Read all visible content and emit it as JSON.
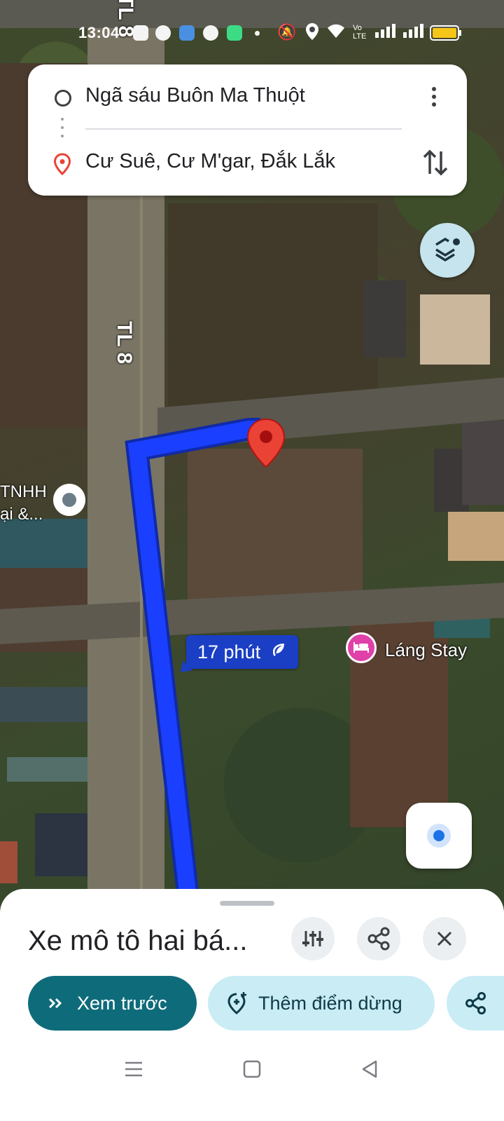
{
  "status_bar": {
    "time": "13:04",
    "app_icons": [
      "zalo-icon",
      "app-icon",
      "app-icon",
      "app-icon",
      "app-icon"
    ],
    "system_icons": [
      "mute-icon",
      "location-icon",
      "wifi-icon",
      "volte-icon",
      "signal-icon",
      "signal-icon",
      "battery-icon"
    ],
    "volte_text": "Vo LTE"
  },
  "directions": {
    "origin": "Ngã sáu Buôn Ma Thuột",
    "destination": "Cư Suê, Cư M'gar, Đắk Lắk"
  },
  "map": {
    "road_label_top": "TL 8",
    "road_label_mid": "TL 8",
    "duration": "17 phút",
    "duration_icon": "eco-leaf-icon",
    "poi_hotel": "Láng Stay",
    "poi_company_line1": "TNHH",
    "poi_company_line2": "ại &...",
    "route_color": "#1a3fff",
    "pin_color": "#ea4335"
  },
  "bottom_sheet": {
    "travel_mode": "Xe mô tô hai bá...",
    "preview_label": "Xem trước",
    "add_stop_label": "Thêm điểm dừng"
  },
  "colors": {
    "primary_button": "#0e6b7a",
    "secondary_button": "#c9ecf5"
  }
}
